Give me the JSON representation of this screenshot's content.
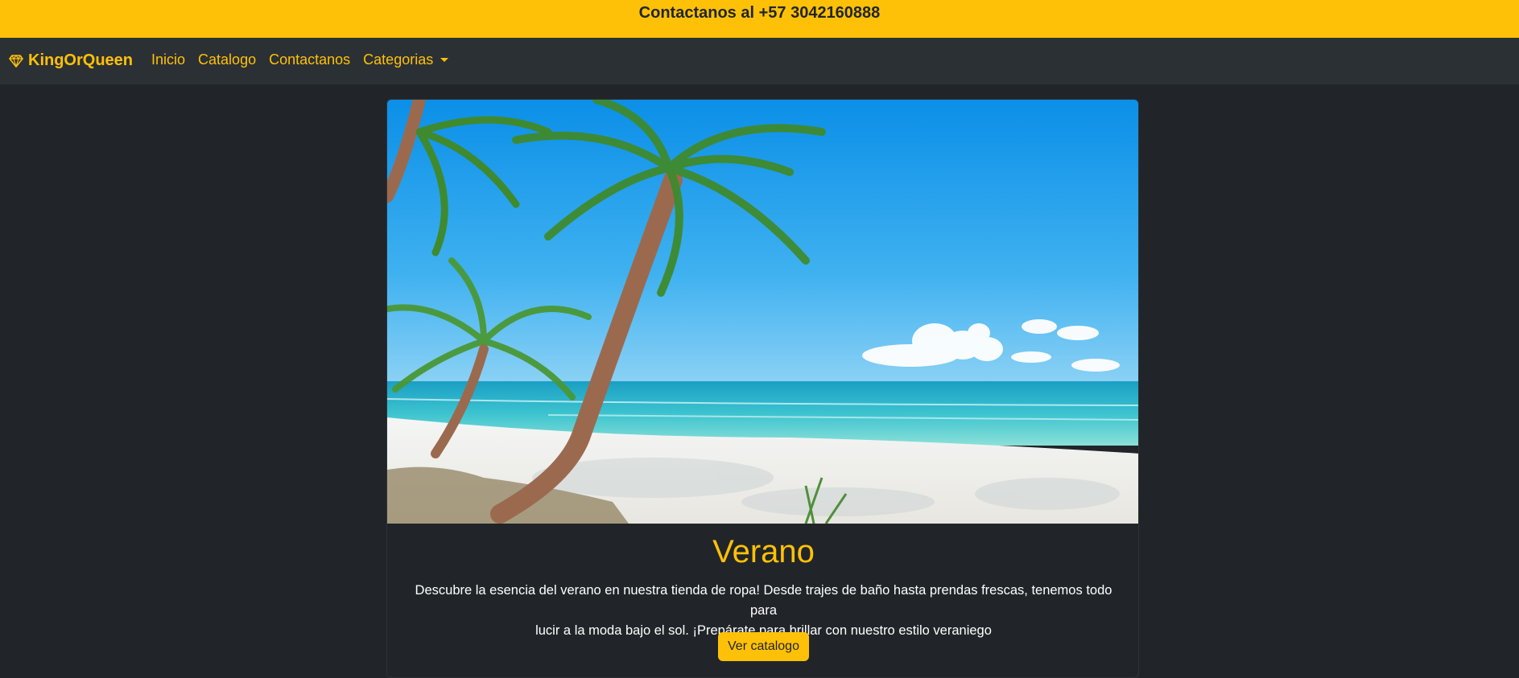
{
  "topbar": {
    "contact_text": "Contactanos al +57 3042160888"
  },
  "navbar": {
    "brand": "KingOrQueen",
    "brand_icon": "gem-icon",
    "links": [
      {
        "label": "Inicio"
      },
      {
        "label": "Catalogo"
      },
      {
        "label": "Contactanos"
      },
      {
        "label": "Categorias",
        "icon": "caret-down-icon"
      }
    ]
  },
  "card": {
    "image": "tropical-beach-with-palm-trees",
    "title": "Verano",
    "text_line1": "Descubre la esencia del verano en nuestra tienda de ropa! Desde trajes de baño hasta prendas frescas, tenemos todo para",
    "text_line2": "lucir a la moda bajo el sol. ¡Prepárate para brillar con nuestro estilo veraniego",
    "button": "Ver catalogo"
  },
  "colors": {
    "accent": "#ffc107",
    "background": "#212529",
    "navbar": "#2b3035"
  }
}
